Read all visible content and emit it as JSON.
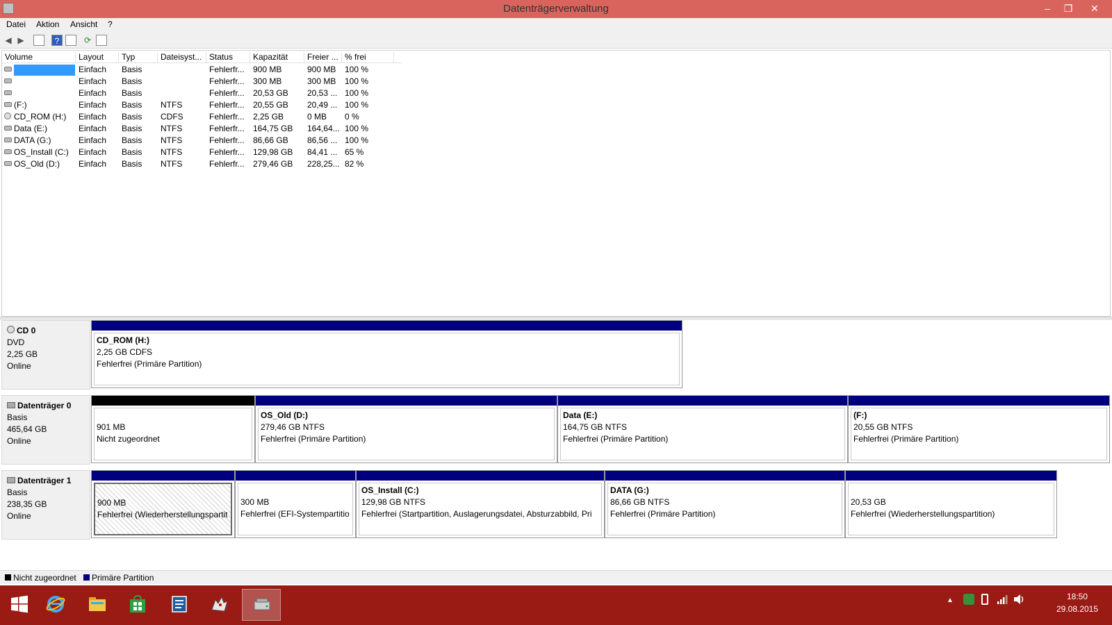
{
  "window": {
    "title": "Datenträgerverwaltung",
    "minimize": "–",
    "maximize": "❐",
    "close": "✕"
  },
  "menu": [
    "Datei",
    "Aktion",
    "Ansicht",
    "?"
  ],
  "toolbar": {
    "back": "◀",
    "forward": "▶",
    "help": "?",
    "refresh": "⟳"
  },
  "volume_list": {
    "columns": [
      "Volume",
      "Layout",
      "Typ",
      "Dateisyst...",
      "Status",
      "Kapazität",
      "Freier ...",
      "% frei"
    ],
    "rows": [
      {
        "icon": "drive-icon",
        "volume": "",
        "layout": "Einfach",
        "typ": "Basis",
        "fs": "",
        "status": "Fehlerfr...",
        "cap": "900 MB",
        "free": "900 MB",
        "pct": "100 %",
        "selected": true
      },
      {
        "icon": "drive-icon",
        "volume": "",
        "layout": "Einfach",
        "typ": "Basis",
        "fs": "",
        "status": "Fehlerfr...",
        "cap": "300 MB",
        "free": "300 MB",
        "pct": "100 %"
      },
      {
        "icon": "drive-icon",
        "volume": "",
        "layout": "Einfach",
        "typ": "Basis",
        "fs": "",
        "status": "Fehlerfr...",
        "cap": "20,53 GB",
        "free": "20,53 ...",
        "pct": "100 %"
      },
      {
        "icon": "drive-icon",
        "volume": "(F:)",
        "layout": "Einfach",
        "typ": "Basis",
        "fs": "NTFS",
        "status": "Fehlerfr...",
        "cap": "20,55 GB",
        "free": "20,49 ...",
        "pct": "100 %"
      },
      {
        "icon": "cd-icon",
        "volume": "CD_ROM (H:)",
        "layout": "Einfach",
        "typ": "Basis",
        "fs": "CDFS",
        "status": "Fehlerfr...",
        "cap": "2,25 GB",
        "free": "0 MB",
        "pct": "0 %"
      },
      {
        "icon": "drive-icon",
        "volume": "Data (E:)",
        "layout": "Einfach",
        "typ": "Basis",
        "fs": "NTFS",
        "status": "Fehlerfr...",
        "cap": "164,75 GB",
        "free": "164,64...",
        "pct": "100 %"
      },
      {
        "icon": "drive-icon",
        "volume": "DATA (G:)",
        "layout": "Einfach",
        "typ": "Basis",
        "fs": "NTFS",
        "status": "Fehlerfr...",
        "cap": "86,66 GB",
        "free": "86,56 ...",
        "pct": "100 %"
      },
      {
        "icon": "drive-icon",
        "volume": "OS_Install (C:)",
        "layout": "Einfach",
        "typ": "Basis",
        "fs": "NTFS",
        "status": "Fehlerfr...",
        "cap": "129,98 GB",
        "free": "84,41 ...",
        "pct": "65 %"
      },
      {
        "icon": "drive-icon",
        "volume": "OS_Old (D:)",
        "layout": "Einfach",
        "typ": "Basis",
        "fs": "NTFS",
        "status": "Fehlerfr...",
        "cap": "279,46 GB",
        "free": "228,25...",
        "pct": "82 %"
      }
    ]
  },
  "disks": [
    {
      "name": "CD 0",
      "type": "DVD",
      "size": "2,25 GB",
      "state": "Online",
      "icon": "cd-icon",
      "partitions": [
        {
          "name": "CD_ROM  (H:)",
          "size": "2,25 GB CDFS",
          "status": "Fehlerfrei (Primäre Partition)",
          "bar": "primary"
        }
      ]
    },
    {
      "name": "Datenträger 0",
      "type": "Basis",
      "size": "465,64 GB",
      "state": "Online",
      "icon": "disk-icon",
      "partitions": [
        {
          "name": "",
          "size": "901 MB",
          "status": "Nicht zugeordnet",
          "bar": "unallocated"
        },
        {
          "name": "OS_Old  (D:)",
          "size": "279,46 GB NTFS",
          "status": "Fehlerfrei (Primäre Partition)",
          "bar": "primary"
        },
        {
          "name": "Data  (E:)",
          "size": "164,75 GB NTFS",
          "status": "Fehlerfrei (Primäre Partition)",
          "bar": "primary"
        },
        {
          "name": "(F:)",
          "size": "20,55 GB NTFS",
          "status": "Fehlerfrei (Primäre Partition)",
          "bar": "primary"
        }
      ]
    },
    {
      "name": "Datenträger 1",
      "type": "Basis",
      "size": "238,35 GB",
      "state": "Online",
      "icon": "disk-icon",
      "partitions": [
        {
          "name": "",
          "size": "900 MB",
          "status": "Fehlerfrei (Wiederherstellungspartit",
          "bar": "primary",
          "selected": true
        },
        {
          "name": "",
          "size": "300 MB",
          "status": "Fehlerfrei (EFI-Systempartitio",
          "bar": "primary"
        },
        {
          "name": "OS_Install  (C:)",
          "size": "129,98 GB NTFS",
          "status": "Fehlerfrei (Startpartition, Auslagerungsdatei, Absturzabbild, Pri",
          "bar": "primary"
        },
        {
          "name": "DATA  (G:)",
          "size": "86,66 GB NTFS",
          "status": "Fehlerfrei (Primäre Partition)",
          "bar": "primary"
        },
        {
          "name": "",
          "size": "20,53 GB",
          "status": "Fehlerfrei (Wiederherstellungspartition)",
          "bar": "primary"
        }
      ]
    }
  ],
  "legend": {
    "unallocated": "Nicht zugeordnet",
    "primary": "Primäre Partition",
    "colors": {
      "unallocated": "#000000",
      "primary": "#00007f"
    }
  },
  "taskbar": {
    "apps": [
      "start-icon",
      "internet-explorer-icon",
      "file-explorer-icon",
      "store-icon",
      "notepad-icon",
      "wolf-app-icon",
      "disk-management-icon"
    ],
    "clock_time": "18:50",
    "clock_date": "29.08.2015"
  }
}
